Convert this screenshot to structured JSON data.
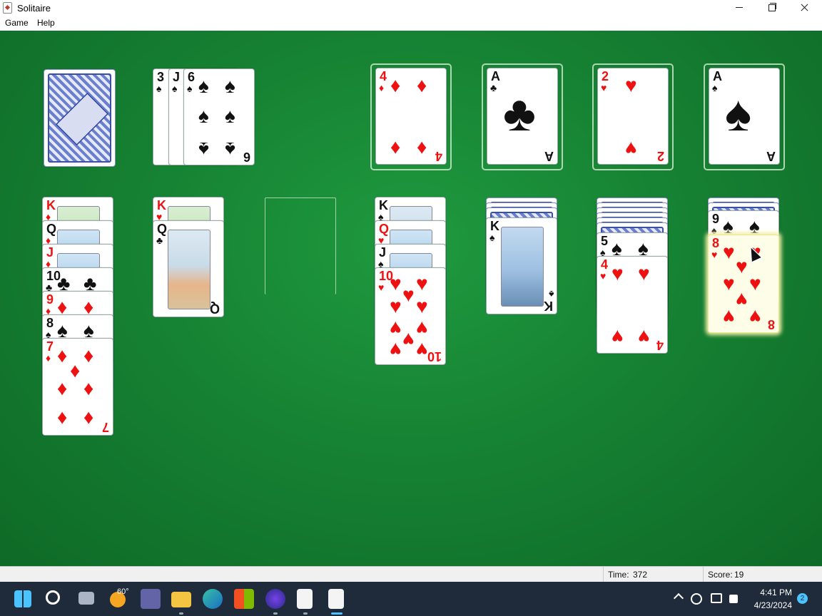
{
  "window": {
    "title": "Solitaire"
  },
  "menu": {
    "game": "Game",
    "help": "Help"
  },
  "status": {
    "time_label": "Time:",
    "time_value": "372",
    "score_label": "Score:",
    "score_value": "19"
  },
  "taskbar": {
    "weather_temp": "60°",
    "time": "4:41 PM",
    "date": "4/23/2024",
    "notification_count": "2"
  },
  "colors": {
    "felt": "#168233",
    "red_suit": "#e11111",
    "black_suit": "#111111",
    "taskbar": "#1f2a3a",
    "accent": "#4cc2ff"
  },
  "stock": {
    "face_down": true
  },
  "waste": [
    {
      "rank": "3",
      "suit": "♠"
    },
    {
      "rank": "J",
      "suit": "♠"
    },
    {
      "rank": "6",
      "suit": "♠"
    }
  ],
  "foundations": [
    {
      "rank": "4",
      "suit": "♦"
    },
    {
      "rank": "A",
      "suit": "♣"
    },
    {
      "rank": "2",
      "suit": "♥"
    },
    {
      "rank": "A",
      "suit": "♠"
    }
  ],
  "tableau": [
    {
      "face_down": 0,
      "cards": [
        "K♦",
        "Q♦",
        "J♦",
        "10♣",
        "9♦",
        "8♠",
        "7♦"
      ]
    },
    {
      "face_down": 0,
      "cards": [
        "K♥",
        "Q♣"
      ]
    },
    {
      "face_down": 0,
      "cards": []
    },
    {
      "face_down": 0,
      "cards": [
        "K♠",
        "Q♥",
        "J♠",
        "10♥"
      ]
    },
    {
      "face_down": 3,
      "cards": [
        "K♠"
      ]
    },
    {
      "face_down": 6,
      "cards": [
        "5♠",
        "4♥"
      ]
    },
    {
      "face_down": 2,
      "cards": [
        "9♠",
        "8♥"
      ]
    }
  ],
  "ranks": {
    "t1": [
      "K",
      "Q",
      "J",
      "10",
      "9",
      "8",
      "7"
    ],
    "t2": [
      "K",
      "Q"
    ],
    "t4": [
      "K",
      "Q",
      "J",
      "10"
    ],
    "t5": [
      "K"
    ],
    "t6": [
      "5",
      "4"
    ],
    "t7": [
      "9",
      "8"
    ]
  },
  "suits": {
    "t1": [
      "♦",
      "♦",
      "♦",
      "♣",
      "♦",
      "♠",
      "♦"
    ],
    "t2": [
      "♥",
      "♣"
    ],
    "t4": [
      "♠",
      "♥",
      "♠",
      "♥"
    ],
    "t5": [
      "♠"
    ],
    "t6": [
      "♠",
      "♥"
    ],
    "t7": [
      "♠",
      "♥"
    ]
  }
}
